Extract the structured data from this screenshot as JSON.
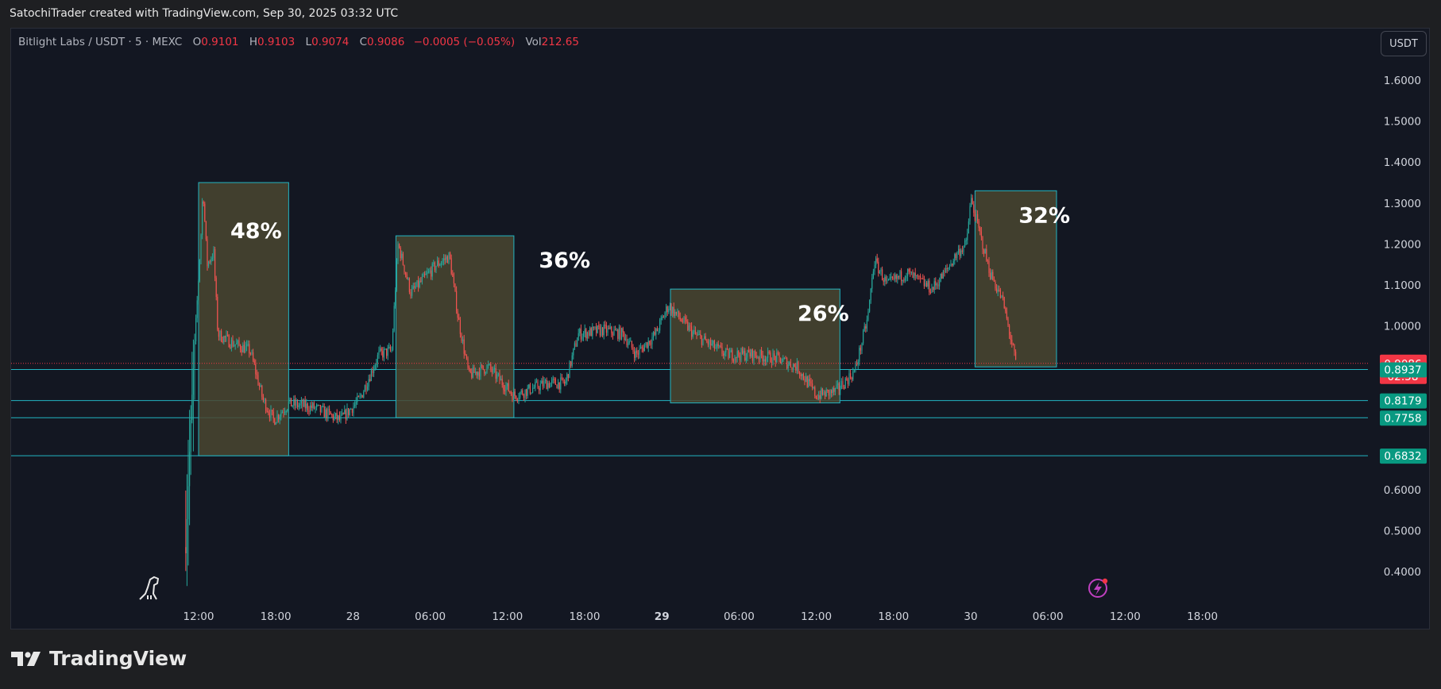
{
  "caption": "SatochiTrader created with TradingView.com, Sep 30, 2025 03:32 UTC",
  "legend": {
    "symbol": "Bitlight Labs / USDT · 5 · MEXC",
    "o_label": "O",
    "o": "0.9101",
    "h_label": "H",
    "h": "0.9103",
    "l_label": "L",
    "l": "0.9074",
    "c_label": "C",
    "c": "0.9086",
    "change": "−0.0005 (−0.05%)",
    "vol_label": "Vol",
    "vol": "212.65"
  },
  "currency_button": "USDT",
  "footer_brand": "TradingView",
  "icons": [
    "dinosaur-icon",
    "lightning-icon",
    "tradingview-logo-icon"
  ],
  "colors": {
    "up": "#26a69a",
    "down": "#ef5350",
    "box_fill": "#4a4630",
    "box_stroke": "#22b5c2",
    "current_price": "#f23645",
    "level_badge": "#089981"
  },
  "chart_data": {
    "type": "candlestick",
    "interval": "5m",
    "ylim": [
      0.38,
      1.7
    ],
    "y_ticks": [
      "1.6000",
      "1.5000",
      "1.4000",
      "1.3000",
      "1.2000",
      "1.1000",
      "1.0000",
      "0.6000",
      "0.5000",
      "0.4000"
    ],
    "x_ticks": [
      {
        "label": "12:00",
        "bold": false
      },
      {
        "label": "18:00",
        "bold": false
      },
      {
        "label": "28",
        "bold": false
      },
      {
        "label": "06:00",
        "bold": false
      },
      {
        "label": "12:00",
        "bold": false
      },
      {
        "label": "18:00",
        "bold": false
      },
      {
        "label": "29",
        "bold": true
      },
      {
        "label": "06:00",
        "bold": false
      },
      {
        "label": "12:00",
        "bold": false
      },
      {
        "label": "18:00",
        "bold": false
      },
      {
        "label": "30",
        "bold": false
      },
      {
        "label": "06:00",
        "bold": false
      },
      {
        "label": "12:00",
        "bold": false
      },
      {
        "label": "18:00",
        "bold": false
      }
    ],
    "path": [
      [
        "Sep 27 11:00",
        0.46
      ],
      [
        "Sep 27 11:20",
        0.72
      ],
      [
        "Sep 27 11:40",
        0.94
      ],
      [
        "Sep 27 12:10",
        1.21
      ],
      [
        "Sep 27 12:20",
        1.34
      ],
      [
        "Sep 27 12:40",
        1.15
      ],
      [
        "Sep 27 13:10",
        1.18
      ],
      [
        "Sep 27 13:30",
        0.98
      ],
      [
        "Sep 27 14:30",
        0.96
      ],
      [
        "Sep 27 16:00",
        0.94
      ],
      [
        "Sep 27 17:00",
        0.82
      ],
      [
        "Sep 27 17:50",
        0.77
      ],
      [
        "Sep 27 19:00",
        0.81
      ],
      [
        "Sep 27 21:00",
        0.8
      ],
      [
        "Sep 27 23:00",
        0.77
      ],
      [
        "Sep 28 00:30",
        0.82
      ],
      [
        "Sep 28 02:00",
        0.93
      ],
      [
        "Sep 28 03:00",
        0.94
      ],
      [
        "Sep 28 03:30",
        1.2
      ],
      [
        "Sep 28 04:30",
        1.08
      ],
      [
        "Sep 28 06:30",
        1.15
      ],
      [
        "Sep 28 07:30",
        1.17
      ],
      [
        "Sep 28 08:10",
        1.02
      ],
      [
        "Sep 28 09:00",
        0.88
      ],
      [
        "Sep 28 10:30",
        0.9
      ],
      [
        "Sep 28 12:30",
        0.83
      ],
      [
        "Sep 28 15:00",
        0.86
      ],
      [
        "Sep 28 16:30",
        0.86
      ],
      [
        "Sep 28 17:30",
        0.98
      ],
      [
        "Sep 28 19:30",
        0.99
      ],
      [
        "Sep 28 21:00",
        0.98
      ],
      [
        "Sep 28 22:00",
        0.93
      ],
      [
        "Sep 28 23:30",
        0.98
      ],
      [
        "Sep 29 00:30",
        1.05
      ],
      [
        "Sep 29 02:30",
        0.98
      ],
      [
        "Sep 29 05:00",
        0.93
      ],
      [
        "Sep 29 07:00",
        0.93
      ],
      [
        "Sep 29 09:00",
        0.92
      ],
      [
        "Sep 29 10:30",
        0.9
      ],
      [
        "Sep 29 12:00",
        0.83
      ],
      [
        "Sep 29 13:30",
        0.84
      ],
      [
        "Sep 29 15:00",
        0.89
      ],
      [
        "Sep 29 16:00",
        1.02
      ],
      [
        "Sep 29 16:30",
        1.16
      ],
      [
        "Sep 29 17:30",
        1.1
      ],
      [
        "Sep 29 19:00",
        1.13
      ],
      [
        "Sep 29 21:00",
        1.09
      ],
      [
        "Sep 29 22:00",
        1.13
      ],
      [
        "Sep 29 23:00",
        1.18
      ],
      [
        "Sep 29 23:40",
        1.2
      ],
      [
        "Sep 30 00:00",
        1.31
      ],
      [
        "Sep 30 01:30",
        1.13
      ],
      [
        "Sep 30 02:30",
        1.06
      ],
      [
        "Sep 30 03:30",
        0.91
      ]
    ],
    "boxes": [
      {
        "label": "48%",
        "start": "Sep 27 12:00",
        "end": "Sep 27 19:00",
        "top": 1.35,
        "bottom": 0.683
      },
      {
        "label": "36%",
        "start": "Sep 28 03:20",
        "end": "Sep 28 12:30",
        "top": 1.22,
        "bottom": 0.776
      },
      {
        "label": "26%",
        "start": "Sep 29 00:40",
        "end": "Sep 29 13:50",
        "top": 1.09,
        "bottom": 0.812
      },
      {
        "label": "32%",
        "start": "Sep 30 00:20",
        "end": "Sep 30 06:40",
        "top": 1.33,
        "bottom": 0.9
      }
    ],
    "levels": [
      {
        "value": 0.8937,
        "label": "0.8937"
      },
      {
        "value": 0.8179,
        "label": "0.8179"
      },
      {
        "value": 0.7758,
        "label": "0.7758"
      },
      {
        "value": 0.6832,
        "label": "0.6832"
      }
    ],
    "current_price": {
      "value": 0.9086,
      "label": "0.9086",
      "countdown": "02:58"
    },
    "grid": false
  }
}
